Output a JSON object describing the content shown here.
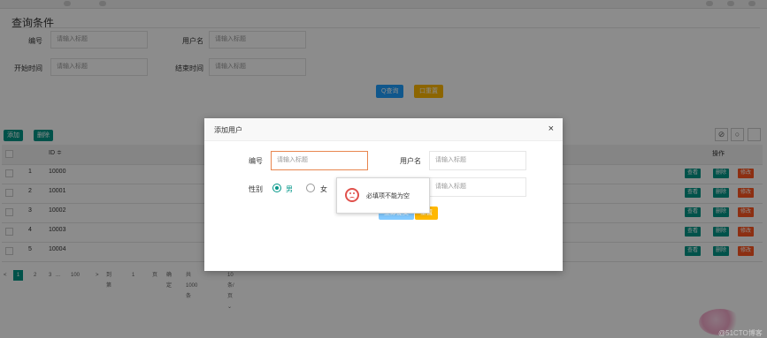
{
  "search": {
    "section_title": "查询条件",
    "id_label": "编号",
    "id_placeholder": "请输入标题",
    "username_label": "用户名",
    "username_placeholder": "请输入标题",
    "start_label": "开始时间",
    "start_placeholder": "请输入标题",
    "end_label": "结束时间",
    "end_placeholder": "请输入标题",
    "query_button": "Q查询",
    "reset_button": "口重置"
  },
  "toolbar": {
    "add": "添加",
    "delete": "删除"
  },
  "table": {
    "id_header": "ID ≑",
    "action_header": "操作",
    "rows": [
      {
        "index": "1",
        "id": "10000"
      },
      {
        "index": "2",
        "id": "10001"
      },
      {
        "index": "3",
        "id": "10002"
      },
      {
        "index": "4",
        "id": "10003"
      },
      {
        "index": "5",
        "id": "10004"
      }
    ],
    "view_label": "查看",
    "delete_label": "删除",
    "edit_label": "修改"
  },
  "pagination": {
    "prev": "<",
    "pages": [
      "1",
      "2",
      "3",
      "...",
      "100"
    ],
    "next": ">",
    "goto_label": "到第",
    "goto_value": "1",
    "page_unit": "页",
    "confirm": "确定",
    "total": "共 1000 条",
    "page_size": "10 条/页 ⌄"
  },
  "modal": {
    "title": "添加用户",
    "close": "×",
    "id_label": "编号",
    "id_placeholder": "请输入标题",
    "username_label": "用户名",
    "username_placeholder": "请输入标题",
    "gender_label": "性别",
    "gender_male": "男",
    "gender_female": "女",
    "field2_placeholder": "请输入标题",
    "submit": "立即提交",
    "reset": "重置"
  },
  "tooltip": {
    "message": "必填项不能为空"
  },
  "watermark": "@51CTO博客",
  "colors": {
    "teal": "#009688",
    "blue": "#1E9FFF",
    "orange": "#FFB800",
    "red": "#FF5722"
  }
}
